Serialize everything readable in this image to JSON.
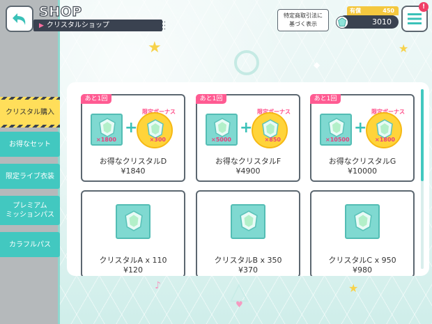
{
  "header": {
    "title": "SHOP",
    "subtitle": "クリスタルショップ",
    "law_button_label": "特定商取引法に\n基づく表示",
    "wallet": {
      "paid_label": "有償",
      "paid_value": "450",
      "total_value": "3010"
    },
    "notification_badge": "!"
  },
  "sidebar": {
    "items": [
      {
        "label": "クリスタル購入",
        "active": true
      },
      {
        "label": "お得なセット",
        "active": false
      },
      {
        "label": "限定ライブ衣装",
        "active": false
      },
      {
        "label": "プレミアム\nミッションパス",
        "active": false
      },
      {
        "label": "カラフルパス",
        "active": false
      }
    ]
  },
  "products": [
    {
      "tag": "あと1回",
      "bonus_label": "限定ボーナス",
      "base_qty": "×1800",
      "bonus_qty": "×300",
      "name": "お得なクリスタルD",
      "price": "¥1840"
    },
    {
      "tag": "あと1回",
      "bonus_label": "限定ボーナス",
      "base_qty": "×5000",
      "bonus_qty": "×850",
      "name": "お得なクリスタルF",
      "price": "¥4900"
    },
    {
      "tag": "あと1回",
      "bonus_label": "限定ボーナス",
      "base_qty": "×10500",
      "bonus_qty": "×1800",
      "name": "お得なクリスタルG",
      "price": "¥10000"
    },
    {
      "name": "クリスタルA x 110",
      "price": "¥120"
    },
    {
      "name": "クリスタルB x 350",
      "price": "¥370"
    },
    {
      "name": "クリスタルC x 950",
      "price": "¥980"
    }
  ],
  "colors": {
    "accent_teal": "#42c8c0",
    "active_yellow": "#ffde5a",
    "tag_pink": "#ff5b92",
    "dark": "#3a4250"
  },
  "icons": {
    "back": "back-arrow-icon",
    "menu": "hamburger-menu-icon",
    "crystal": "crystal-gem-icon"
  }
}
